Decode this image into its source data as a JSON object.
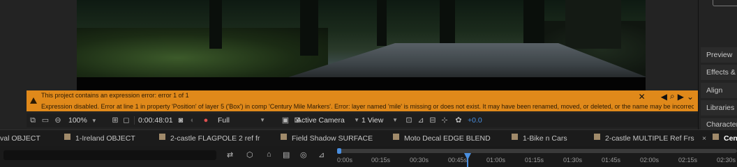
{
  "viewer": {
    "error": {
      "line1": "This project contains an expression error: error 1 of 1",
      "line2": "Expression disabled. Error at line 1 in property 'Position' of layer 5 ('Box') in comp 'Century Mile Markers'.   Error: layer named 'mile' is missing or does not exist. It may have been renamed, moved, or deleted, or the name may be incorrect."
    },
    "toolbar": {
      "zoom": "100%",
      "timecode": "0:00:48:01",
      "resolution": "Full",
      "camera": "Active Camera",
      "views": "1 View",
      "exposure": "+0.0"
    }
  },
  "right_panel": {
    "items": [
      "Preview",
      "Effects & Presets",
      "Align",
      "Libraries",
      "Character"
    ]
  },
  "timeline": {
    "tabs": [
      "val OBJECT",
      "1-Ireland OBJECT",
      "2-castle FLAGPOLE 2 ref fr",
      "Field Shadow SURFACE",
      "Moto Decal EDGE BLEND",
      "1-Bike n Cars",
      "2-castle MULTIPLE Ref Frs",
      "Cen"
    ],
    "close_glyph": "×",
    "ruler": [
      "0:00s",
      "00:15s",
      "00:30s",
      "00:45s",
      "01:00s",
      "01:15s",
      "01:30s",
      "01:45s",
      "02:00s",
      "02:15s",
      "02:30s"
    ]
  },
  "colors": {
    "error_banner": "#e0891a",
    "accent_blue": "#4a8fe0"
  }
}
